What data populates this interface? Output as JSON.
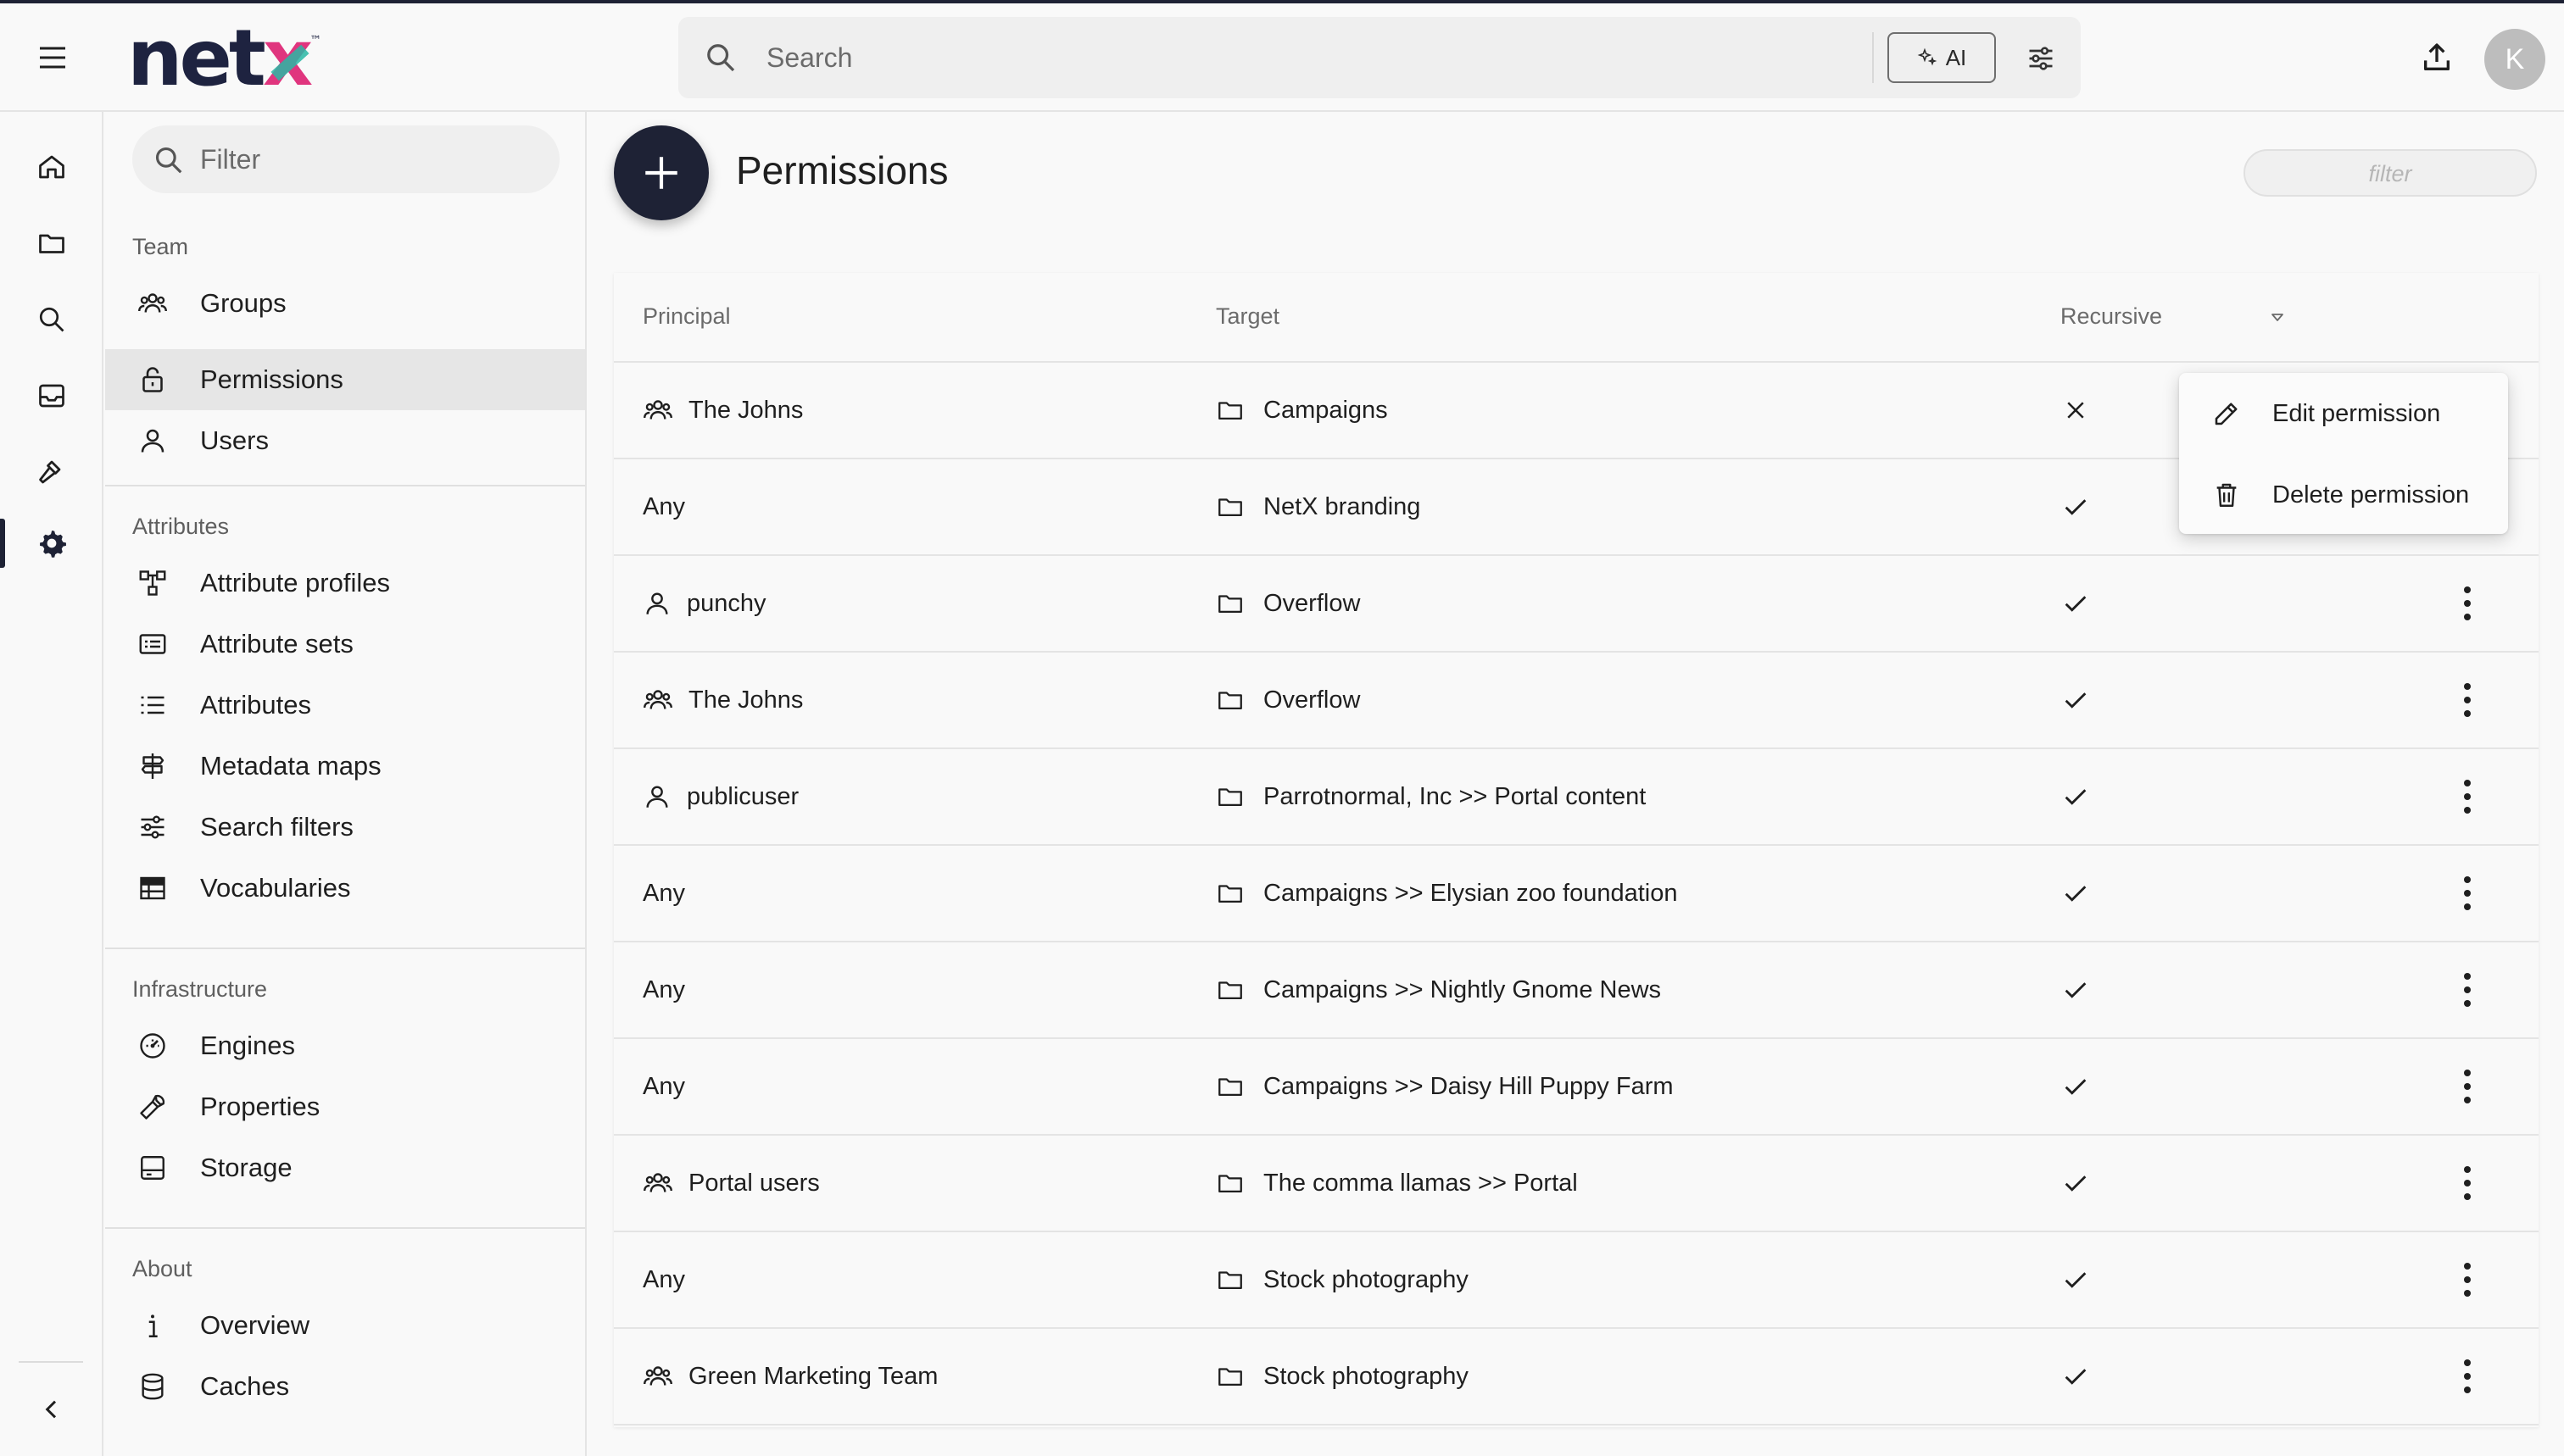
{
  "app": {
    "logo_text": "netx",
    "logo_tm": "™"
  },
  "header": {
    "search_placeholder": "Search",
    "ai_label": "AI",
    "avatar_initial": "K"
  },
  "rail": {
    "items": [
      "home-icon",
      "folder-icon",
      "search-icon",
      "inbox-icon",
      "hammer-icon",
      "gear-icon"
    ],
    "active_item": "gear-icon"
  },
  "sidebar": {
    "filter_placeholder": "Filter",
    "sections": [
      {
        "title": "Team",
        "items": [
          {
            "label": "Groups",
            "icon": "groups-icon"
          },
          {
            "label": "Permissions",
            "icon": "lock-icon",
            "active": true
          },
          {
            "label": "Users",
            "icon": "user-icon"
          }
        ]
      },
      {
        "title": "Attributes",
        "items": [
          {
            "label": "Attribute profiles",
            "icon": "profiles-icon"
          },
          {
            "label": "Attribute sets",
            "icon": "list-box-icon"
          },
          {
            "label": "Attributes",
            "icon": "list-icon"
          },
          {
            "label": "Metadata maps",
            "icon": "signpost-icon"
          },
          {
            "label": "Search filters",
            "icon": "sliders-icon"
          },
          {
            "label": "Vocabularies",
            "icon": "table-icon"
          }
        ]
      },
      {
        "title": "Infrastructure",
        "items": [
          {
            "label": "Engines",
            "icon": "engine-icon"
          },
          {
            "label": "Properties",
            "icon": "wrench-icon"
          },
          {
            "label": "Storage",
            "icon": "storage-icon"
          }
        ]
      },
      {
        "title": "About",
        "items": [
          {
            "label": "Overview",
            "icon": "info-icon"
          },
          {
            "label": "Caches",
            "icon": "database-icon"
          }
        ]
      }
    ]
  },
  "main": {
    "title": "Permissions",
    "filter_placeholder": "filter",
    "columns": {
      "principal": "Principal",
      "target": "Target",
      "recursive": "Recursive"
    },
    "rows": [
      {
        "principal": "The Johns",
        "principal_type": "group",
        "target": "Campaigns",
        "recursive": false
      },
      {
        "principal": "Any",
        "principal_type": "none",
        "target": "NetX branding",
        "recursive": true
      },
      {
        "principal": "punchy",
        "principal_type": "user",
        "target": "Overflow",
        "recursive": true
      },
      {
        "principal": "The Johns",
        "principal_type": "group",
        "target": "Overflow",
        "recursive": true
      },
      {
        "principal": "publicuser",
        "principal_type": "user",
        "target": "Parrotnormal, Inc >> Portal content",
        "recursive": true
      },
      {
        "principal": "Any",
        "principal_type": "none",
        "target": "Campaigns >> Elysian zoo foundation",
        "recursive": true
      },
      {
        "principal": "Any",
        "principal_type": "none",
        "target": "Campaigns >> Nightly Gnome News",
        "recursive": true
      },
      {
        "principal": "Any",
        "principal_type": "none",
        "target": "Campaigns >> Daisy Hill Puppy Farm",
        "recursive": true
      },
      {
        "principal": "Portal users",
        "principal_type": "group",
        "target": "The comma llamas >> Portal",
        "recursive": true
      },
      {
        "principal": "Any",
        "principal_type": "none",
        "target": "Stock photography",
        "recursive": true
      },
      {
        "principal": "Green Marketing Team",
        "principal_type": "group",
        "target": "Stock photography",
        "recursive": true
      }
    ]
  },
  "context_menu": {
    "edit_label": "Edit permission",
    "delete_label": "Delete permission"
  },
  "colors": {
    "brand_navy": "#1e2235",
    "brand_pink": "#e0357e",
    "brand_teal": "#29b7a4"
  }
}
